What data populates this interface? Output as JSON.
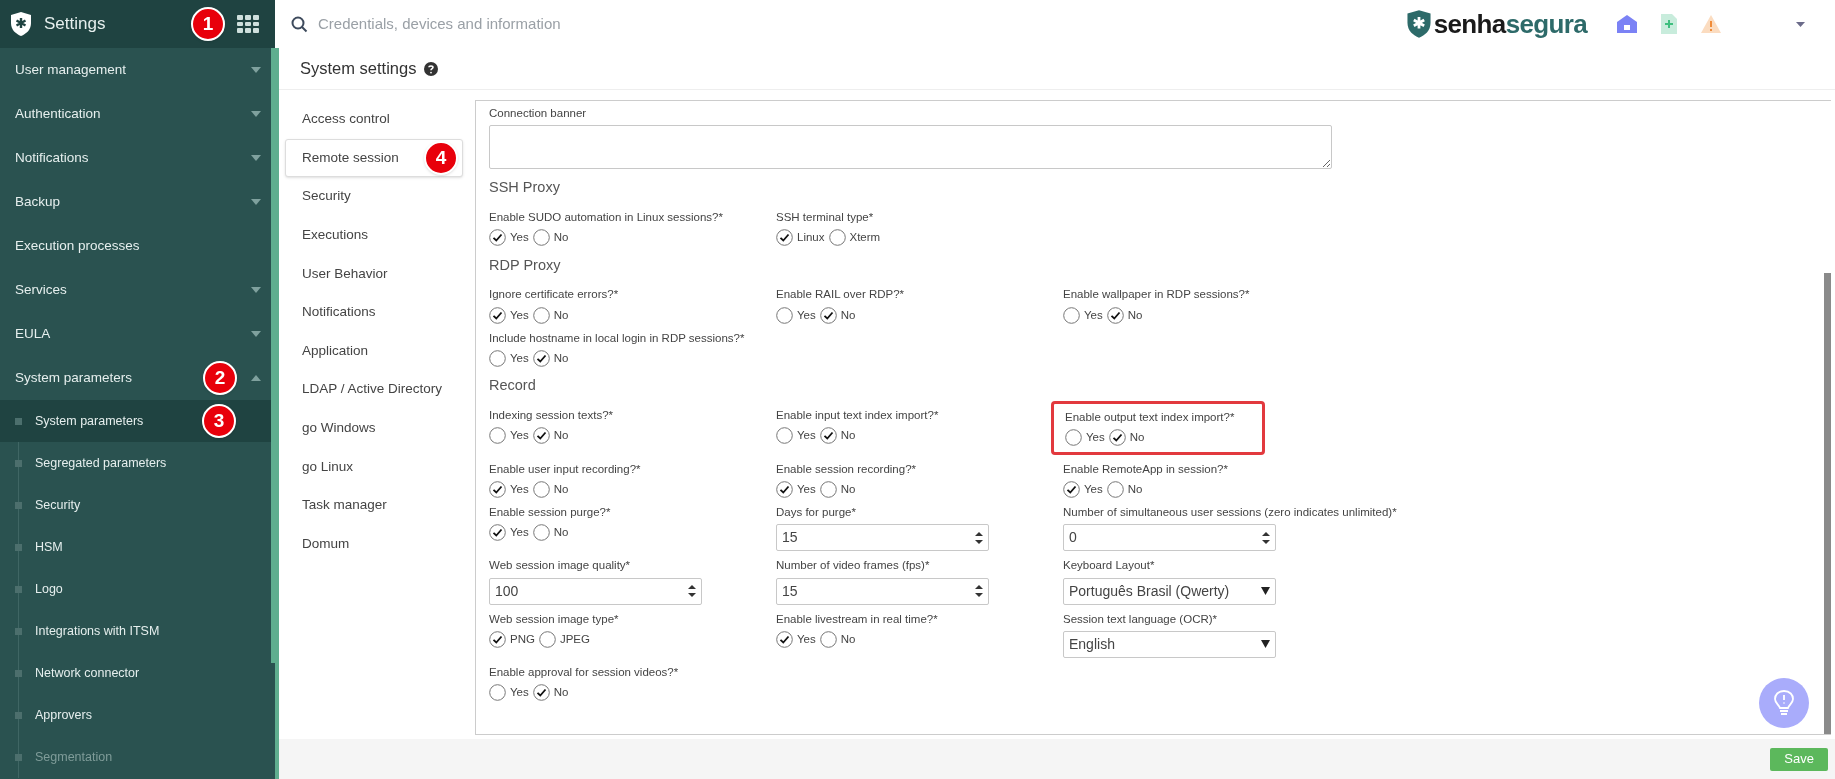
{
  "sidebar": {
    "title": "Settings",
    "callout": "1",
    "items": [
      {
        "label": "User management",
        "kind": "group",
        "expanded": false
      },
      {
        "label": "Authentication",
        "kind": "group",
        "expanded": false
      },
      {
        "label": "Notifications",
        "kind": "group",
        "expanded": false
      },
      {
        "label": "Backup",
        "kind": "group",
        "expanded": false
      },
      {
        "label": "Execution processes",
        "kind": "link"
      },
      {
        "label": "Services",
        "kind": "group",
        "expanded": false
      },
      {
        "label": "EULA",
        "kind": "group",
        "expanded": false
      },
      {
        "label": "System parameters",
        "kind": "group",
        "expanded": true,
        "callout": "2",
        "children": [
          {
            "label": "System parameters",
            "selected": true,
            "disabled": false,
            "callout": "3"
          },
          {
            "label": "Segregated parameters",
            "selected": false,
            "disabled": false
          },
          {
            "label": "Security",
            "selected": false,
            "disabled": false
          },
          {
            "label": "HSM",
            "selected": false,
            "disabled": false
          },
          {
            "label": "Logo",
            "selected": false,
            "disabled": false
          },
          {
            "label": "Integrations with ITSM",
            "selected": false,
            "disabled": false
          },
          {
            "label": "Network connector",
            "selected": false,
            "disabled": false
          },
          {
            "label": "Approvers",
            "selected": false,
            "disabled": false
          },
          {
            "label": "Segmentation",
            "selected": false,
            "disabled": true
          }
        ]
      }
    ]
  },
  "search": {
    "placeholder": "Credentials, devices and information"
  },
  "brand": {
    "dark": "senha",
    "accent": "segura"
  },
  "page": {
    "title": "System settings"
  },
  "tabs": [
    {
      "label": "Access control",
      "selected": false
    },
    {
      "label": "Remote session",
      "selected": true,
      "callout": "4"
    },
    {
      "label": "Security",
      "selected": false
    },
    {
      "label": "Executions",
      "selected": false
    },
    {
      "label": "User Behavior",
      "selected": false
    },
    {
      "label": "Notifications",
      "selected": false
    },
    {
      "label": "Application",
      "selected": false
    },
    {
      "label": "LDAP / Active Directory",
      "selected": false
    },
    {
      "label": "go Windows",
      "selected": false
    },
    {
      "label": "go Linux",
      "selected": false
    },
    {
      "label": "Task manager",
      "selected": false
    },
    {
      "label": "Domum",
      "selected": false
    }
  ],
  "sections": [
    {
      "fields": [
        {
          "kind": "textarea",
          "label": "Connection banner"
        }
      ]
    },
    {
      "heading": "SSH Proxy",
      "fields": [
        {
          "kind": "radio",
          "label": "Enable SUDO automation in Linux sessions?*",
          "options": [
            {
              "label": "Yes",
              "selected": true
            },
            {
              "label": "No",
              "selected": false
            }
          ]
        },
        {
          "kind": "radio",
          "label": "SSH terminal type*",
          "options": [
            {
              "label": "Linux",
              "selected": true
            },
            {
              "label": "Xterm",
              "selected": false
            }
          ]
        }
      ]
    },
    {
      "heading": "RDP Proxy",
      "fields": [
        {
          "kind": "radio",
          "label": "Ignore certificate errors?*",
          "options": [
            {
              "label": "Yes",
              "selected": true
            },
            {
              "label": "No",
              "selected": false
            }
          ]
        },
        {
          "kind": "radio",
          "label": "Enable RAIL over RDP?*",
          "options": [
            {
              "label": "Yes",
              "selected": false
            },
            {
              "label": "No",
              "selected": true
            }
          ]
        },
        {
          "kind": "radio",
          "label": "Enable wallpaper in RDP sessions?*",
          "options": [
            {
              "label": "Yes",
              "selected": false
            },
            {
              "label": "No",
              "selected": true
            }
          ]
        },
        {
          "kind": "radio",
          "label": "Include hostname in local login in RDP sessions?*",
          "options": [
            {
              "label": "Yes",
              "selected": false
            },
            {
              "label": "No",
              "selected": true
            }
          ]
        }
      ]
    },
    {
      "heading": "Record",
      "fields": [
        {
          "kind": "radio",
          "label": "Indexing session texts?*",
          "options": [
            {
              "label": "Yes",
              "selected": false
            },
            {
              "label": "No",
              "selected": true
            }
          ]
        },
        {
          "kind": "radio",
          "label": "Enable input text index import?*",
          "options": [
            {
              "label": "Yes",
              "selected": false
            },
            {
              "label": "No",
              "selected": true
            }
          ]
        },
        {
          "kind": "radio",
          "label": "Enable output text index import?*",
          "highlighted": true,
          "options": [
            {
              "label": "Yes",
              "selected": false
            },
            {
              "label": "No",
              "selected": true
            }
          ]
        },
        {
          "kind": "radio",
          "label": "Enable user input recording?*",
          "options": [
            {
              "label": "Yes",
              "selected": true
            },
            {
              "label": "No",
              "selected": false
            }
          ]
        },
        {
          "kind": "radio",
          "label": "Enable session recording?*",
          "options": [
            {
              "label": "Yes",
              "selected": true
            },
            {
              "label": "No",
              "selected": false
            }
          ]
        },
        {
          "kind": "radio",
          "label": "Enable RemoteApp in session?*",
          "options": [
            {
              "label": "Yes",
              "selected": true
            },
            {
              "label": "No",
              "selected": false
            }
          ]
        },
        {
          "kind": "radio",
          "label": "Enable session purge?*",
          "options": [
            {
              "label": "Yes",
              "selected": true
            },
            {
              "label": "No",
              "selected": false
            }
          ]
        },
        {
          "kind": "number",
          "label": "Days for purge*",
          "value": "15"
        },
        {
          "kind": "number",
          "label": "Number of simultaneous user sessions (zero indicates unlimited)*",
          "value": "0"
        },
        {
          "kind": "number",
          "label": "Web session image quality*",
          "value": "100"
        },
        {
          "kind": "number",
          "label": "Number of video frames (fps)*",
          "value": "15"
        },
        {
          "kind": "select",
          "label": "Keyboard Layout*",
          "value": "Português Brasil (Qwerty)"
        },
        {
          "kind": "radio",
          "label": "Web session image type*",
          "options": [
            {
              "label": "PNG",
              "selected": true
            },
            {
              "label": "JPEG",
              "selected": false
            }
          ]
        },
        {
          "kind": "radio",
          "label": "Enable livestream in real time?*",
          "options": [
            {
              "label": "Yes",
              "selected": true
            },
            {
              "label": "No",
              "selected": false
            }
          ]
        },
        {
          "kind": "select",
          "label": "Session text language (OCR)*",
          "value": "English"
        },
        {
          "kind": "radio",
          "label": "Enable approval for session videos?*",
          "options": [
            {
              "label": "Yes",
              "selected": false
            },
            {
              "label": "No",
              "selected": true
            }
          ]
        }
      ]
    }
  ],
  "footer": {
    "save": "Save"
  }
}
